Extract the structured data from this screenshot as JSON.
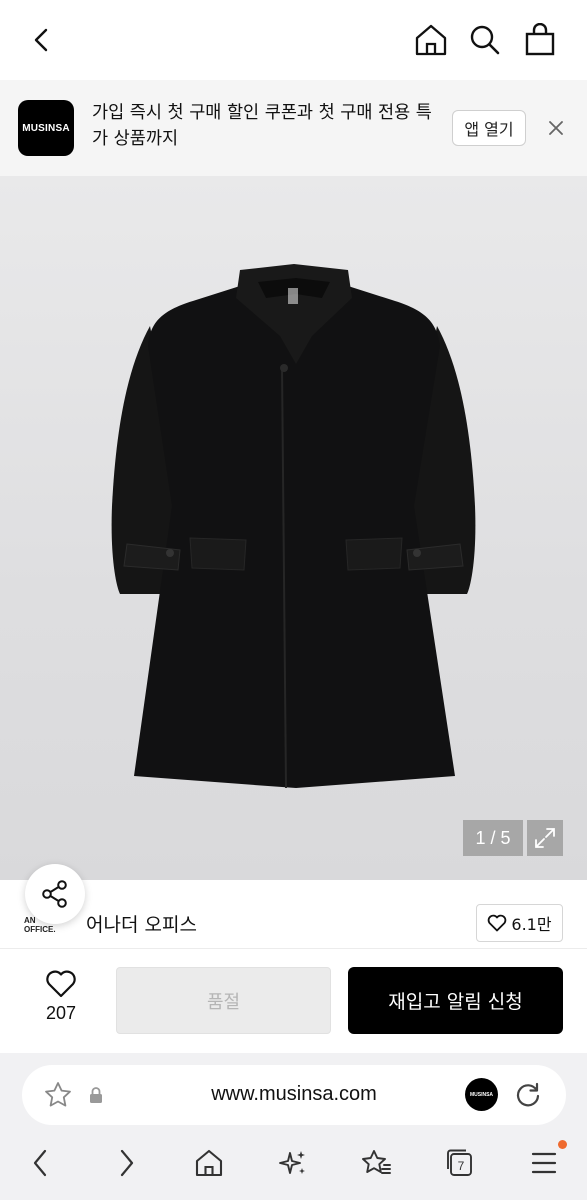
{
  "topbar": {
    "back_icon": "chevron-left-icon",
    "home_icon": "home-icon",
    "search_icon": "search-icon",
    "cart_icon": "shopping-bag-icon"
  },
  "banner": {
    "logo_text": "MUSINSA",
    "message": "가입 즉시 첫 구매 할인 쿠폰과 첫 구매 전용 특가 상품까지",
    "open_app_label": "앱 열기",
    "close_icon": "close-icon"
  },
  "gallery": {
    "counter": "1 / 5",
    "expand_icon": "expand-icon",
    "image_subject": "black wool single coat"
  },
  "brand": {
    "logo_line1": "AN",
    "logo_line2": "OFFICE.",
    "name": "어나더 오피스",
    "likes": "6.1만",
    "share_icon": "share-icon"
  },
  "actions": {
    "wish_count": "207",
    "soldout_label": "품절",
    "restock_label": "재입고 알림 신청"
  },
  "browser": {
    "url": "www.musinsa.com",
    "tab_count": "7",
    "mini_logo_text": "MUSINSA",
    "notification_color": "#ef6a2e"
  },
  "colors": {
    "primary_button": "#000000",
    "disabled_button": "#ebebeb",
    "banner_bg": "#f5f5f5"
  }
}
